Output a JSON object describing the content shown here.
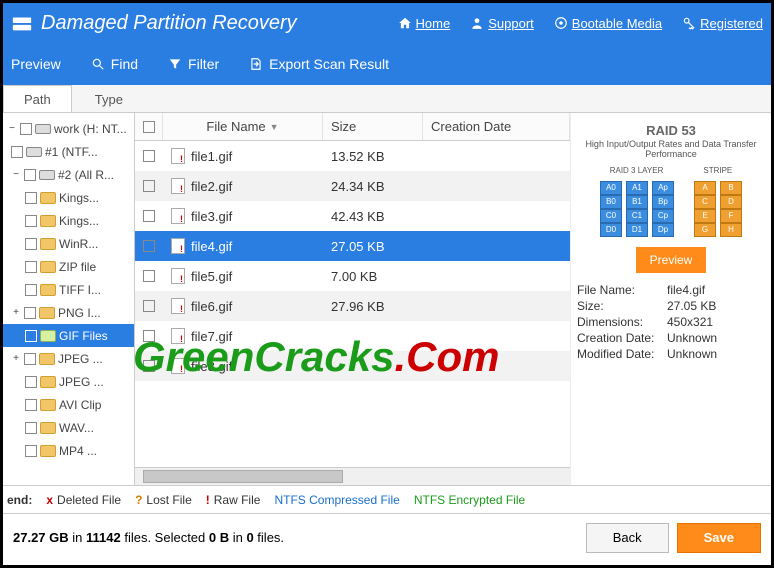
{
  "header": {
    "title": "Damaged Partition Recovery",
    "nav": {
      "home": "Home",
      "support": "Support",
      "bootable": "Bootable Media",
      "registered": "Registered"
    }
  },
  "toolbar": {
    "preview": "Preview",
    "find": "Find",
    "filter": "Filter",
    "export": "Export Scan Result"
  },
  "tabs": {
    "path": "Path",
    "type": "Type"
  },
  "tree": {
    "work": "work (H: NT...",
    "n1": "#1 (NTF...",
    "n2": "#2 (All R...",
    "kings1": "Kings...",
    "kings2": "Kings...",
    "winr": "WinR...",
    "zip": "ZIP file",
    "tiff": "TIFF I...",
    "png": "PNG I...",
    "gif": "GIF Files",
    "jpeg1": "JPEG ...",
    "jpeg2": "JPEG ...",
    "avi": "AVI Clip",
    "wav": "WAV...",
    "mp4": "MP4 ..."
  },
  "columns": {
    "name": "File Name",
    "size": "Size",
    "date": "Creation Date"
  },
  "files": [
    {
      "name": "file1.gif",
      "size": "13.52 KB"
    },
    {
      "name": "file2.gif",
      "size": "24.34 KB"
    },
    {
      "name": "file3.gif",
      "size": "42.43 KB"
    },
    {
      "name": "file4.gif",
      "size": "27.05 KB",
      "selected": true
    },
    {
      "name": "file5.gif",
      "size": "7.00 KB"
    },
    {
      "name": "file6.gif",
      "size": "27.96 KB"
    },
    {
      "name": "file7.gif",
      "size": ""
    },
    {
      "name": "file8.gif",
      "size": ""
    }
  ],
  "preview_panel": {
    "raid_title": "RAID 53",
    "raid_sub": "High Input/Output Rates and Data Transfer Performance",
    "raid_labels": {
      "left": "RAID 3 LAYER",
      "right": "STRIPE"
    },
    "preview_btn": "Preview",
    "meta": {
      "name_label": "File Name:",
      "name_val": "file4.gif",
      "size_label": "Size:",
      "size_val": "27.05 KB",
      "dim_label": "Dimensions:",
      "dim_val": "450x321",
      "cd_label": "Creation Date:",
      "cd_val": "Unknown",
      "md_label": "Modified Date:",
      "md_val": "Unknown"
    }
  },
  "legend": {
    "label": "end:",
    "deleted": "Deleted File",
    "lost": "Lost File",
    "raw": "Raw File",
    "ntfsc": "NTFS Compressed File",
    "ntfse": "NTFS Encrypted File"
  },
  "status": {
    "gb": "27.27 GB",
    "in": " in ",
    "files": "11142",
    "files_t": " files.  Selected ",
    "b": "0 B",
    "in2": " in ",
    "fc": "0",
    "end": " files."
  },
  "buttons": {
    "back": "Back",
    "save": "Save"
  },
  "watermark": {
    "a": "GreenCracks",
    "b": ".Com"
  }
}
